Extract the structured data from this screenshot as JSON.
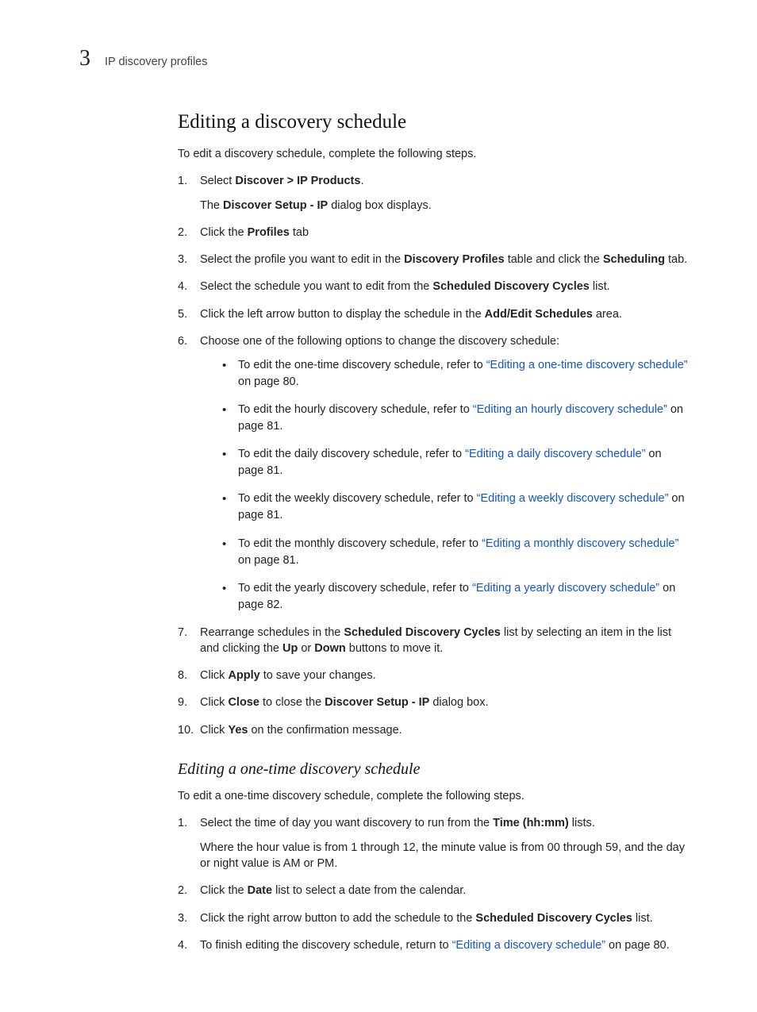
{
  "header": {
    "chapter_num": "3",
    "section_label": "IP discovery profiles"
  },
  "h1": "Editing a discovery schedule",
  "lead1": "To edit a discovery schedule, complete the following steps.",
  "steps": {
    "s1_pre": "Select ",
    "s1_b": "Discover > IP Products",
    "s1_post": ".",
    "s1_sub_pre": "The ",
    "s1_sub_b": "Discover Setup - IP",
    "s1_sub_post": " dialog box displays.",
    "s2_pre": "Click the ",
    "s2_b": "Profiles",
    "s2_post": " tab",
    "s3_pre": "Select the profile you want to edit in the ",
    "s3_b1": "Discovery Profiles",
    "s3_mid": " table and click the ",
    "s3_b2": "Scheduling",
    "s3_post": " tab.",
    "s4_pre": "Select the schedule you want to edit from the ",
    "s4_b": "Scheduled Discovery Cycles",
    "s4_post": " list.",
    "s5_pre": "Click the left arrow button to display the schedule in the ",
    "s5_b": "Add/Edit Schedules",
    "s5_post": " area.",
    "s6": "Choose one of the following options to change the discovery schedule:",
    "bullets": {
      "b1_pre": "To edit the one-time discovery schedule, refer to ",
      "b1_link": "“Editing a one-time discovery schedule”",
      "b1_post": " on page 80.",
      "b2_pre": "To edit the hourly discovery schedule, refer to ",
      "b2_link": "“Editing an hourly discovery schedule”",
      "b2_post": " on page 81.",
      "b3_pre": "To edit the daily discovery schedule, refer to ",
      "b3_link": "“Editing a daily discovery schedule”",
      "b3_post": " on page 81.",
      "b4_pre": "To edit the weekly discovery schedule, refer to ",
      "b4_link": "“Editing a weekly discovery schedule”",
      "b4_post": " on page 81.",
      "b5_pre": "To edit the monthly discovery schedule, refer to ",
      "b5_link": "“Editing a monthly discovery schedule”",
      "b5_post": " on page 81.",
      "b6_pre": "To edit the yearly discovery schedule, refer to ",
      "b6_link": "“Editing a yearly discovery schedule”",
      "b6_post": " on page 82."
    },
    "s7_pre": "Rearrange schedules in the ",
    "s7_b1": "Scheduled Discovery Cycles",
    "s7_mid1": " list by selecting an item in the list and clicking the ",
    "s7_b2": "Up",
    "s7_mid2": " or ",
    "s7_b3": "Down",
    "s7_post": " buttons to move it.",
    "s8_pre": "Click ",
    "s8_b": "Apply",
    "s8_post": " to save your changes.",
    "s9_pre": "Click ",
    "s9_b1": "Close",
    "s9_mid": " to close the ",
    "s9_b2": "Discover Setup - IP",
    "s9_post": " dialog box.",
    "s10_pre": "Click ",
    "s10_b": "Yes",
    "s10_post": " on the confirmation message."
  },
  "h2": "Editing a one-time discovery schedule",
  "lead2": "To edit a one-time discovery schedule, complete the following steps.",
  "steps2": {
    "s1_pre": "Select the time of day you want discovery to run from the ",
    "s1_b": "Time (hh:mm)",
    "s1_post": " lists.",
    "s1_sub": "Where the hour value is from 1 through 12, the minute value is from 00 through 59, and the day or night value is AM or PM.",
    "s2_pre": "Click the ",
    "s2_b": "Date",
    "s2_post": " list to select a date from the calendar.",
    "s3_pre": "Click the right arrow button to add the schedule to the ",
    "s3_b": "Scheduled Discovery Cycles",
    "s3_post": " list.",
    "s4_pre": "To finish editing the discovery schedule, return to ",
    "s4_link": "“Editing a discovery schedule”",
    "s4_post": " on page 80."
  }
}
